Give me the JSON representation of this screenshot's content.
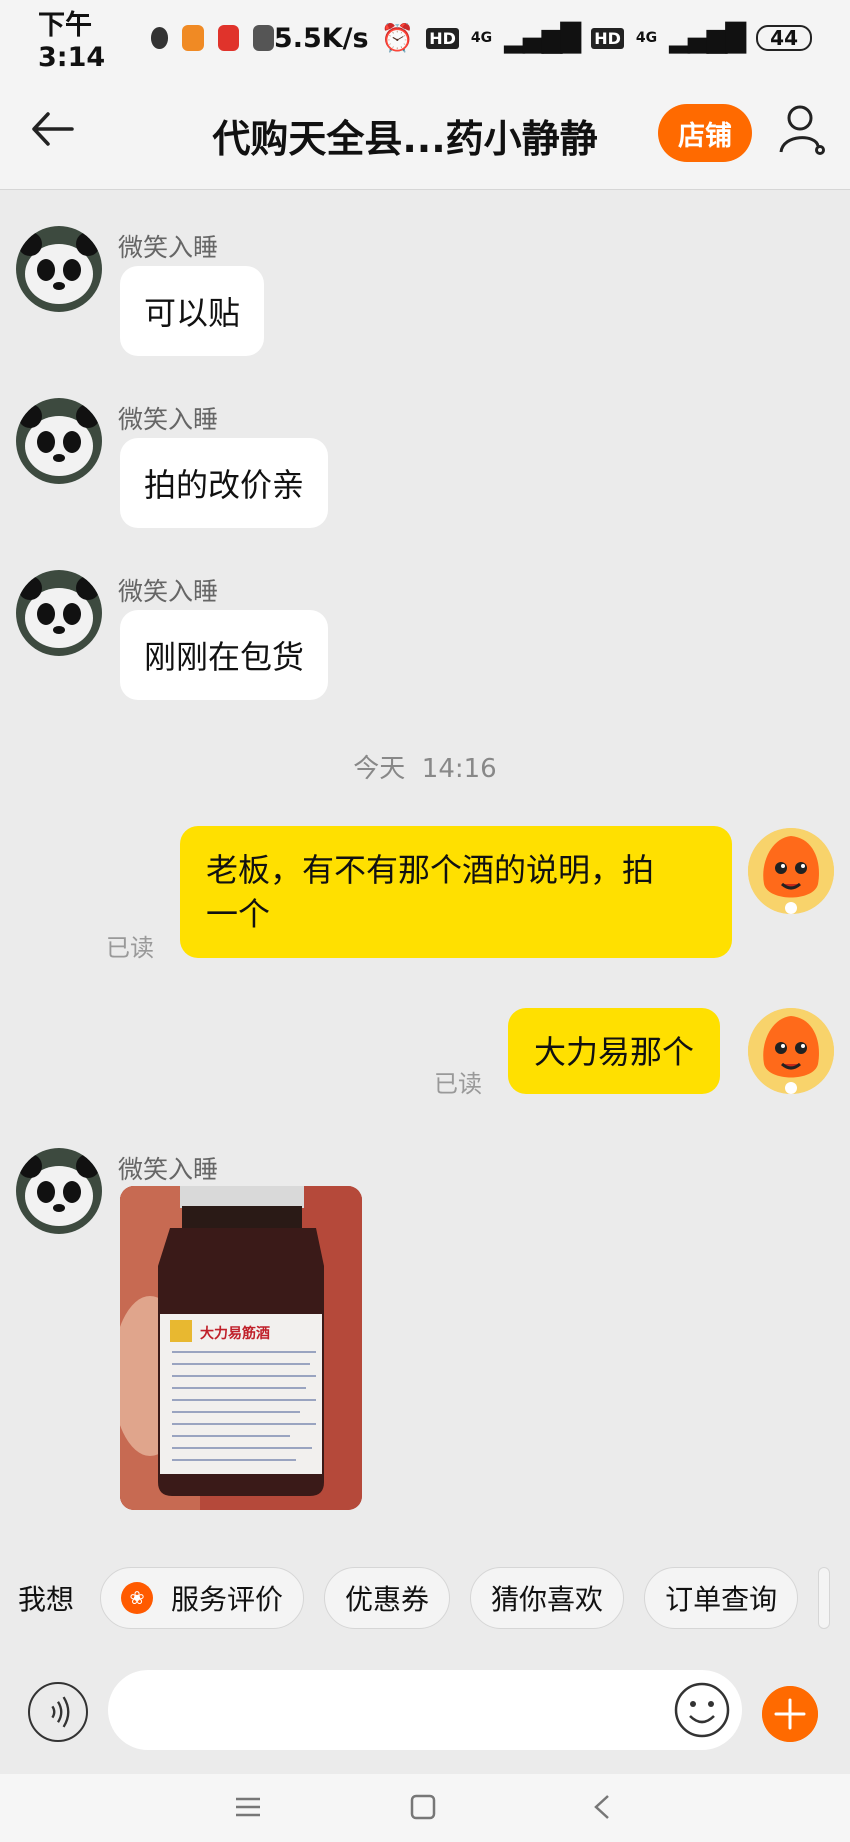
{
  "status_bar": {
    "time": "下午3:14",
    "speed": "5.5K/s",
    "hd1": "HD",
    "net1": "4G",
    "hd2": "HD",
    "net2": "4G",
    "battery": "44"
  },
  "header": {
    "title": "代购天全县...药小静静",
    "shop_button": "店铺"
  },
  "messages": [
    {
      "side": "left",
      "sender": "微笑入睡",
      "text": "可以贴"
    },
    {
      "side": "left",
      "sender": "微笑入睡",
      "text": "拍的改价亲"
    },
    {
      "side": "left",
      "sender": "微笑入睡",
      "text": "刚刚在包货"
    },
    {
      "side": "right",
      "text_line1": "老板，有不有那个酒的说明，拍",
      "text_line2": "一个",
      "status": "已读"
    },
    {
      "side": "right",
      "text": "大力易那个",
      "status": "已读"
    },
    {
      "side": "left",
      "sender": "微笑入睡",
      "image_label": "大力易筋酒"
    }
  ],
  "divider": {
    "date": "今天",
    "time": "14:16"
  },
  "quick_bar": {
    "label": "我想",
    "chips": [
      "服务评价",
      "优惠券",
      "猜你喜欢",
      "订单查询"
    ]
  },
  "input": {
    "placeholder": ""
  },
  "colors": {
    "accent": "#ff6a00",
    "bubble_self": "#ffe000",
    "bubble_other": "#ffffff",
    "background": "#ebebeb"
  }
}
